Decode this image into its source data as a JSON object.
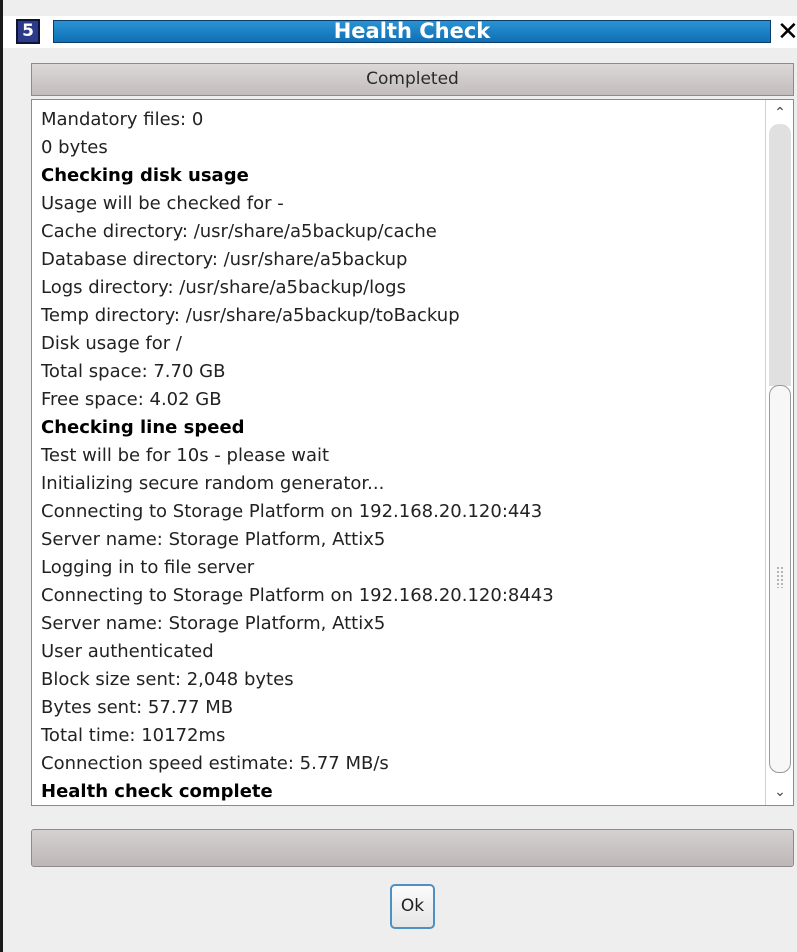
{
  "window": {
    "app_icon_text": "5",
    "title": "Health Check",
    "close_icon": "close-icon"
  },
  "status": {
    "label": "Completed"
  },
  "log": {
    "lines": [
      {
        "text": "Mandatory files: 0",
        "bold": false
      },
      {
        "text": "0 bytes",
        "bold": false
      },
      {
        "text": "Checking disk usage",
        "bold": true
      },
      {
        "text": "Usage will be checked for -",
        "bold": false
      },
      {
        "text": "Cache directory: /usr/share/a5backup/cache",
        "bold": false
      },
      {
        "text": "Database directory: /usr/share/a5backup",
        "bold": false
      },
      {
        "text": "Logs directory: /usr/share/a5backup/logs",
        "bold": false
      },
      {
        "text": "Temp directory: /usr/share/a5backup/toBackup",
        "bold": false
      },
      {
        "text": "Disk usage for /",
        "bold": false
      },
      {
        "text": "Total space: 7.70 GB",
        "bold": false
      },
      {
        "text": "Free space: 4.02 GB",
        "bold": false
      },
      {
        "text": "Checking line speed",
        "bold": true
      },
      {
        "text": "Test will be for 10s - please wait",
        "bold": false
      },
      {
        "text": "Initializing secure random generator...",
        "bold": false
      },
      {
        "text": "Connecting to Storage Platform on 192.168.20.120:443",
        "bold": false
      },
      {
        "text": "Server name: Storage Platform, Attix5",
        "bold": false
      },
      {
        "text": "Logging in to file server",
        "bold": false
      },
      {
        "text": "Connecting to Storage Platform on 192.168.20.120:8443",
        "bold": false
      },
      {
        "text": "Server name: Storage Platform, Attix5",
        "bold": false
      },
      {
        "text": "User authenticated",
        "bold": false
      },
      {
        "text": "Block size sent: 2,048 bytes",
        "bold": false
      },
      {
        "text": "Bytes sent: 57.77 MB",
        "bold": false
      },
      {
        "text": "Total time: 10172ms",
        "bold": false
      },
      {
        "text": "Connection speed estimate: 5.77 MB/s",
        "bold": false
      },
      {
        "text": "Health check complete",
        "bold": true
      }
    ]
  },
  "scrollbar": {
    "up_arrow": "⌃",
    "down_arrow": "⌄",
    "position_fraction": 0.6
  },
  "progress": {
    "value_fraction": 1.0
  },
  "buttons": {
    "ok_label": "Ok"
  },
  "colors": {
    "title_accent": "#1b82c6",
    "ok_border": "#4c90c4"
  }
}
